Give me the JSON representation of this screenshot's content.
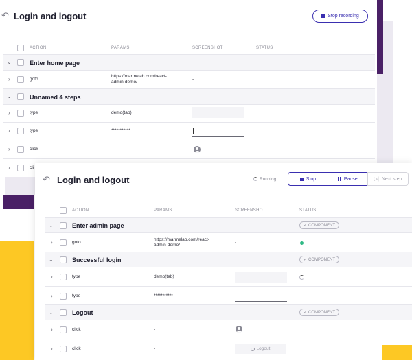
{
  "back_card": {
    "title": "Login and logout",
    "stop_recording_label": "Stop recording",
    "headers": {
      "action": "ACTION",
      "params": "PARAMS",
      "screenshot": "SCREENSHOT",
      "status": "STATUS"
    },
    "groups": [
      {
        "title": "Enter home page"
      },
      {
        "title": "Unnamed 4 steps"
      }
    ],
    "rows": [
      {
        "action": "goto",
        "params": "https://marmelab.com/react-admin-demo/",
        "screenshot": "-"
      },
      {
        "action": "type",
        "params": "demo(tab)"
      },
      {
        "action": "type",
        "params": "***********"
      },
      {
        "action": "click",
        "params": "-"
      },
      {
        "action": "cli"
      }
    ]
  },
  "front_card": {
    "title": "Login and logout",
    "running_label": "Running...",
    "stop_label": "Stop",
    "pause_label": "Pause",
    "next_step_label": "Next step",
    "headers": {
      "action": "ACTION",
      "params": "PARAMS",
      "screenshot": "SCREENSHOT",
      "status": "STATUS"
    },
    "component_badge": "COMPONENT",
    "groups": [
      {
        "title": "Enter admin page"
      },
      {
        "title": "Successful login"
      },
      {
        "title": "Logout"
      }
    ],
    "rows": [
      {
        "action": "goto",
        "params": "https://marmelab.com/react-admin-demo/",
        "screenshot": "-"
      },
      {
        "action": "type",
        "params": "demo(tab)"
      },
      {
        "action": "type",
        "params": "***********"
      },
      {
        "action": "click",
        "params": "-"
      },
      {
        "action": "click",
        "params": "-",
        "screenshot_button": "Logout"
      }
    ]
  },
  "colors": {
    "accent": "#3a2fb0",
    "yellow": "#fdc824",
    "purple": "#4a2066",
    "success": "#2fb985"
  }
}
